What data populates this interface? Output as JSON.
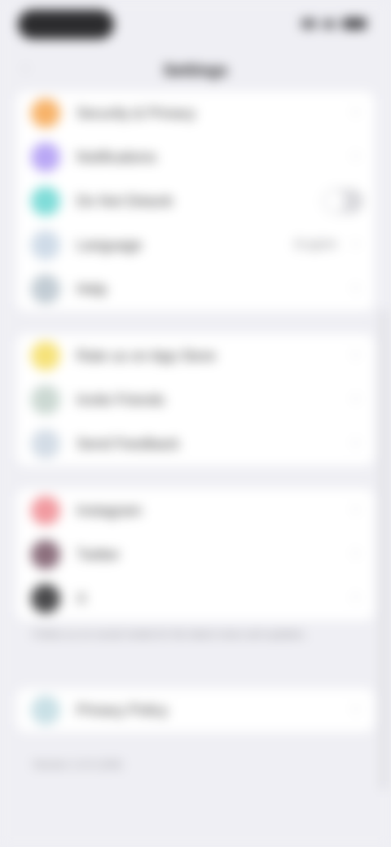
{
  "screen": {
    "title": "Settings"
  },
  "groups": [
    {
      "items": [
        {
          "label": "Security & Privacy",
          "icon": "lock-icon",
          "color": "#f7b36a",
          "accessory": "chevron"
        },
        {
          "label": "Notifications",
          "icon": "bell-icon",
          "color": "#b9a7f5",
          "accessory": "chevron"
        },
        {
          "label": "Do Not Disturb",
          "icon": "moon-icon",
          "color": "#7fdcd8",
          "accessory": "toggle"
        },
        {
          "label": "Language",
          "icon": "globe-icon",
          "color": "#cfdbe8",
          "accessory": "value",
          "value": "English"
        },
        {
          "label": "Help",
          "icon": "help-icon",
          "color": "#c2ccd4",
          "accessory": "chevron"
        }
      ]
    },
    {
      "items": [
        {
          "label": "Rate us on App Store",
          "icon": "star-icon",
          "color": "#f6e27a",
          "accessory": "chevron"
        },
        {
          "label": "Invite Friends",
          "icon": "share-icon",
          "color": "#cbd8d2",
          "accessory": "chevron"
        },
        {
          "label": "Send Feedback",
          "icon": "mail-icon",
          "color": "#d3dce6",
          "accessory": "chevron"
        }
      ]
    },
    {
      "items": [
        {
          "label": "Instagram",
          "icon": "instagram-icon",
          "color": "#f19aa0",
          "accessory": "chevron"
        },
        {
          "label": "Twitter",
          "icon": "twitter-icon",
          "color": "#8c6f7d",
          "accessory": "chevron"
        },
        {
          "label": "X",
          "icon": "x-icon",
          "color": "#4a4a4c",
          "accessory": "chevron"
        }
      ]
    },
    {
      "items": [
        {
          "label": "Privacy Policy",
          "icon": "shield-icon",
          "color": "#c9e0e6",
          "accessory": "chevron"
        }
      ]
    }
  ],
  "footnote": "Follow us on social media for the latest news and updates.",
  "version": "Version 1.0.0 (100)"
}
